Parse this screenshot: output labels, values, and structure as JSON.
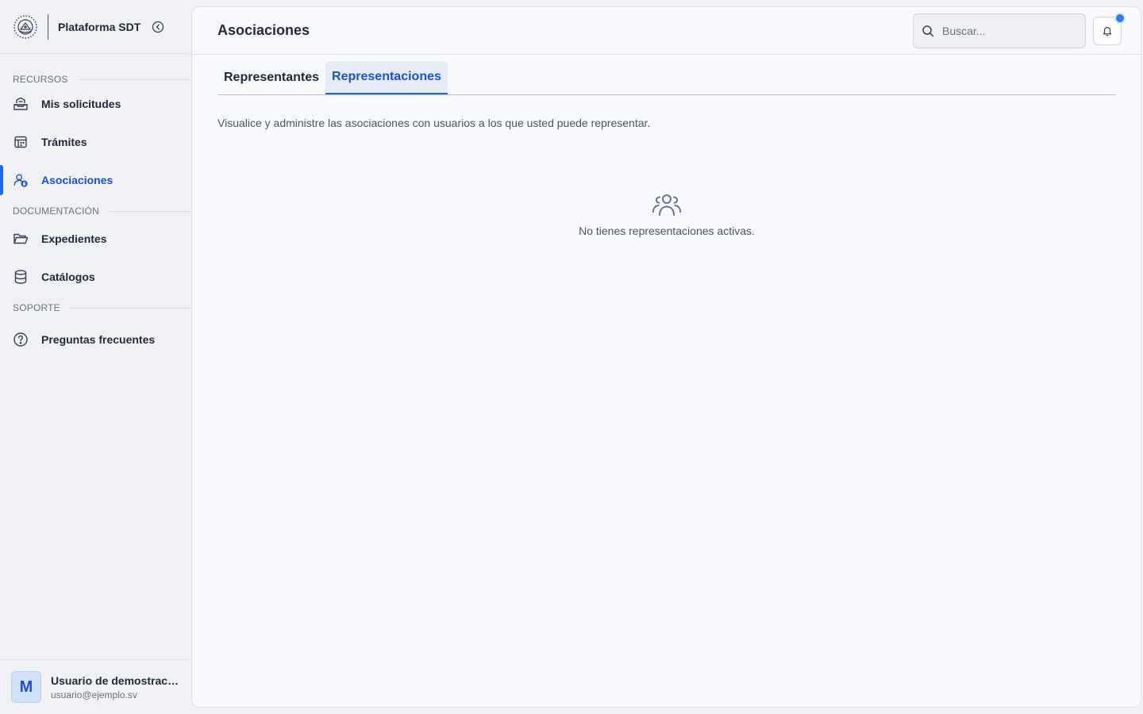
{
  "brand": {
    "title": "Plataforma SDT"
  },
  "sidebar": {
    "sections": [
      {
        "label": "RECURSOS"
      },
      {
        "label": "DOCUMENTACIÓN"
      },
      {
        "label": "SOPORTE"
      }
    ],
    "items": [
      {
        "label": "Mis solicitudes",
        "icon": "inbox-icon"
      },
      {
        "label": "Trámites",
        "icon": "calendar-grid-icon"
      },
      {
        "label": "Asociaciones",
        "icon": "user-shield-icon",
        "active": true
      },
      {
        "label": "Expedientes",
        "icon": "folder-open-icon"
      },
      {
        "label": "Catálogos",
        "icon": "database-icon"
      },
      {
        "label": "Preguntas frecuentes",
        "icon": "help-circle-icon"
      }
    ]
  },
  "user": {
    "initial": "M",
    "name": "Usuario de demostración",
    "email": "usuario@ejemplo.sv"
  },
  "header": {
    "title": "Asociaciones",
    "search_placeholder": "Buscar..."
  },
  "tabs": [
    {
      "label": "Representantes",
      "active": false
    },
    {
      "label": "Representaciones",
      "active": true
    }
  ],
  "main": {
    "description": "Visualice y administre las asociaciones con usuarios a los que usted puede representar.",
    "empty_message": "No tienes representaciones activas."
  },
  "colors": {
    "accent": "#2563eb",
    "active_text": "#1d4ed8",
    "notification_dot": "#2b7bf2"
  }
}
